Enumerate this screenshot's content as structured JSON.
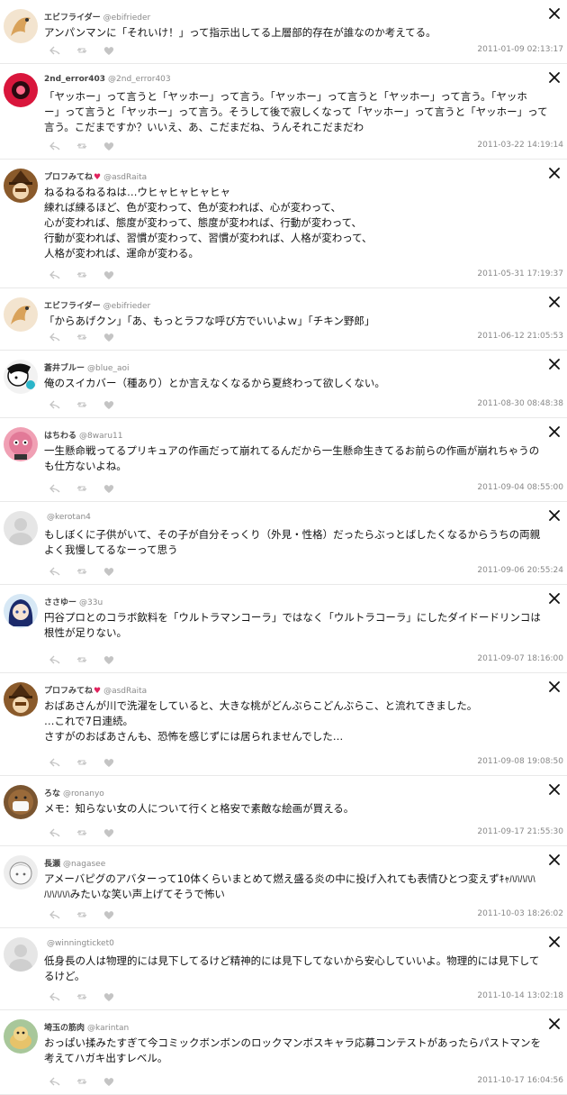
{
  "feed": {
    "posts": [
      {
        "name": "エビフライダー",
        "handle": "@ebifrieder",
        "heart": false,
        "lines": [
          "アンパンマンに「それいけ！」って指示出してる上層部的存在が誰なのか考えてる。"
        ],
        "timestamp": "2011-01-09 02:13:17",
        "avatar_color": "#f3e4cf",
        "avatar_accent": "#c98a3a",
        "avatar_icon": "shrimp-icon"
      },
      {
        "name": "2nd_error403",
        "handle": "@2nd_error403",
        "heart": false,
        "lines": [
          "「ヤッホー」って言うと「ヤッホー」って言う。「ヤッホー」って言うと「ヤッホー」って言う。「ヤッホ",
          "ー」って言うと「ヤッホー」って言う。そうして後で寂しくなって「ヤッホー」って言うと「ヤッホー」って",
          "言う。こだまですか？いいえ、あ、こだまだね、うんそれこだまだわ"
        ],
        "timestamp": "2011-03-22 14:19:14",
        "avatar_color": "#d9163c",
        "avatar_accent": "#3a0d14",
        "avatar_icon": "red-circle-icon"
      },
      {
        "name": "プロフみてね",
        "handle": "@asdRaita",
        "heart": true,
        "lines": [
          "ねるねるねるねは…ウヒャヒャヒャヒャ",
          "練れば練るほど、色が変わって、色が変われば、心が変わって、",
          "心が変われば、態度が変わって、態度が変われば、行動が変わって、",
          "行動が変われば、習慣が変わって、習慣が変われば、人格が変わって、",
          "人格が変われば、運命が変わる。"
        ],
        "timestamp": "2011-05-31 17:19:37",
        "avatar_color": "#8a5a2b",
        "avatar_accent": "#e8c9a0",
        "avatar_icon": "witch-icon"
      },
      {
        "name": "エビフライダー",
        "handle": "@ebifrieder",
        "heart": false,
        "lines": [
          "「からあげクン」「あ、もっとラフな呼び方でいいよｗ」「チキン野郎」"
        ],
        "timestamp": "2011-06-12 21:05:53",
        "avatar_color": "#f3e4cf",
        "avatar_accent": "#c98a3a",
        "avatar_icon": "shrimp-icon"
      },
      {
        "name": "蒼井ブルー",
        "handle": "@blue_aoi",
        "heart": false,
        "lines": [
          "俺のスイカバー（種あり）とか言えなくなるから夏終わって欲しくない。"
        ],
        "timestamp": "2011-08-30 08:48:38",
        "avatar_color": "#f2f2f2",
        "avatar_accent": "#111111",
        "avatar_icon": "sketch-face-icon"
      },
      {
        "name": "はちわる",
        "handle": "@8waru11",
        "heart": false,
        "lines": [
          "一生懸命戦ってるプリキュアの作画だって崩れてるんだから一生懸命生きてるお前らの作画が崩れちゃうの",
          "も仕方ないよね。"
        ],
        "timestamp": "2011-09-04 08:55:00",
        "avatar_color": "#f0a0b4",
        "avatar_accent": "#b05070",
        "avatar_icon": "creature-icon"
      },
      {
        "name": "",
        "handle": "@kerotan4",
        "heart": false,
        "lines": [
          "もしぼくに子供がいて、その子が自分そっくり（外見・性格）だったらぶっとばしたくなるからうちの両親",
          "よく我慢してるなーって思う"
        ],
        "timestamp": "2011-09-06 20:55:24",
        "avatar_color": "#e6e6e6",
        "avatar_accent": "#c8c8c8",
        "avatar_icon": "default-avatar-icon"
      },
      {
        "name": "ささゆー",
        "handle": "@33u",
        "heart": false,
        "lines": [
          "円谷プロとのコラボ飲料を「ウルトラマンコーラ」ではなく「ウルトラコーラ」にしたダイドードリンコは",
          "根性が足りない。"
        ],
        "timestamp": "2011-09-07 18:16:00",
        "avatar_color": "#d7e8f5",
        "avatar_accent": "#1b2a6b",
        "avatar_icon": "anime-girl-icon"
      },
      {
        "name": "プロフみてね",
        "handle": "@asdRaita",
        "heart": true,
        "lines": [
          "おばあさんが川で洗濯をしていると、大きな桃がどんぶらこどんぶらこ、と流れてきました。",
          "…これで7日連続。",
          "さすがのおばあさんも、恐怖を感じずには居られませんでした…"
        ],
        "timestamp": "2011-09-08 19:08:50",
        "avatar_color": "#8a5a2b",
        "avatar_accent": "#e8c9a0",
        "avatar_icon": "witch-icon"
      },
      {
        "name": "ろな",
        "handle": "@ronanyo",
        "heart": false,
        "lines": [
          "メモ：知らない女の人について行くと格安で素敵な絵画が買える。"
        ],
        "timestamp": "2011-09-17 21:55:30",
        "avatar_color": "#7a5530",
        "avatar_accent": "#f4f4f4",
        "avatar_icon": "masked-face-icon"
      },
      {
        "name": "長瀬",
        "handle": "@nagasee",
        "heart": false,
        "lines": [
          "アメーバピグのアバターって10体くらいまとめて燃え盛る炎の中に投げ入れても表情ひとつ変えずｷｬﾊﾊﾊﾊﾊ",
          "ﾊﾊﾊﾊﾊみたいな笑い声上げてそうで怖い"
        ],
        "timestamp": "2011-10-03 18:26:02",
        "avatar_color": "#ededed",
        "avatar_accent": "#9a9a9a",
        "avatar_icon": "sketch-girl-icon"
      },
      {
        "name": "",
        "handle": "@winningticket0",
        "heart": false,
        "lines": [
          "低身長の人は物理的には見下してるけど精神的には見下してないから安心していいよ。物理的には見下して",
          "るけど。"
        ],
        "timestamp": "2011-10-14 13:02:18",
        "avatar_color": "#e6e6e6",
        "avatar_accent": "#c8c8c8",
        "avatar_icon": "default-avatar-icon"
      },
      {
        "name": "埼玉の筋肉",
        "handle": "@karintan",
        "heart": false,
        "lines": [
          "おっぱい揉みたすぎて今コミックボンボンのロックマンボスキャラ応募コンテストがあったらパストマンを",
          "考えてハガキ出すレベル。"
        ],
        "timestamp": "2011-10-17 16:04:56",
        "avatar_color": "#a8c79a",
        "avatar_accent": "#5a4a20",
        "avatar_icon": "animal-icon"
      }
    ]
  },
  "colors": {
    "heart": "#e0245e",
    "timestamp": "#888888",
    "handle": "#8a8a8a",
    "action": "#c4c4c4"
  }
}
